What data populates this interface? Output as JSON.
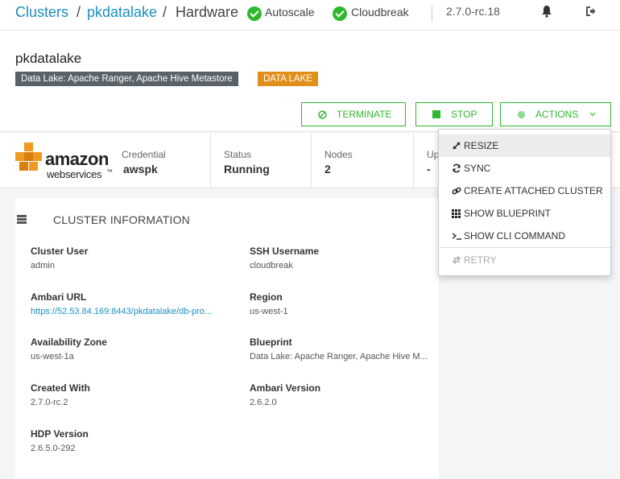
{
  "breadcrumb": {
    "clusters": "Clusters",
    "sep1": "/",
    "cluster": "pkdatalake",
    "sep2": "/",
    "current": "Hardware"
  },
  "statuses": {
    "autoscale": "Autoscale",
    "cloudbreak": "Cloudbreak"
  },
  "version": "2.7.0-rc.18",
  "header": {
    "cluster_name": "pkdatalake",
    "tag_description": "Data Lake: Apache Ranger, Apache Hive Metastore",
    "tag_type": "DATA LAKE"
  },
  "buttons": {
    "terminate": "TERMINATE",
    "stop": "STOP",
    "actions": "ACTIONS"
  },
  "provider_logo": {
    "line1": "amazon",
    "line2": "webservices",
    "tm": "™"
  },
  "stats": {
    "credential": {
      "label": "Credential",
      "value": "awspk"
    },
    "status": {
      "label": "Status",
      "value": "Running"
    },
    "nodes": {
      "label": "Nodes",
      "value": "2"
    },
    "uptime": {
      "label": "Up",
      "value": "-"
    }
  },
  "cluster_info": {
    "title": "CLUSTER INFORMATION",
    "cluster_user": {
      "label": "Cluster User",
      "value": "admin"
    },
    "ssh_username": {
      "label": "SSH Username",
      "value": "cloudbreak"
    },
    "ambari_url": {
      "label": "Ambari URL",
      "value": "https://52.53.84.169:8443/pkdatalake/db-pro..."
    },
    "region": {
      "label": "Region",
      "value": "us-west-1"
    },
    "availability_zone": {
      "label": "Availability Zone",
      "value": "us-west-1a"
    },
    "blueprint": {
      "label": "Blueprint",
      "value": "Data Lake: Apache Ranger, Apache Hive M..."
    },
    "created_with": {
      "label": "Created With",
      "value": "2.7.0-rc.2"
    },
    "ambari_version": {
      "label": "Ambari Version",
      "value": "2.6.2.0"
    },
    "hdp_version": {
      "label": "HDP Version",
      "value": "2.6.5.0-292"
    }
  },
  "actions_menu": {
    "items": [
      {
        "label": "RESIZE",
        "icon": "resize-icon"
      },
      {
        "label": "SYNC",
        "icon": "sync-icon"
      },
      {
        "label": "CREATE ATTACHED CLUSTER",
        "icon": "link-icon"
      },
      {
        "label": "SHOW BLUEPRINT",
        "icon": "grid-icon"
      },
      {
        "label": "SHOW CLI COMMAND",
        "icon": "terminal-icon"
      },
      {
        "label": "RETRY",
        "icon": "retry-icon"
      }
    ]
  },
  "colors": {
    "accent_green": "#2eb82e",
    "link_blue": "#1a8fc0",
    "tag_gray": "#5a6269",
    "tag_orange": "#e0901a",
    "aws_orange": "#f29a1f"
  }
}
